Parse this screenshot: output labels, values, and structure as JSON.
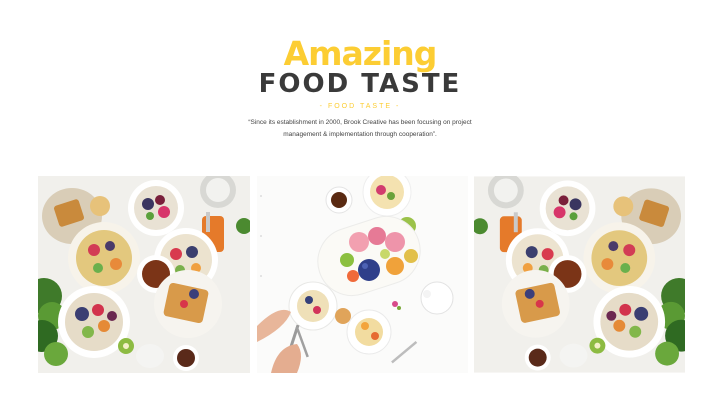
{
  "colors": {
    "accent": "#fccd33",
    "heading": "#3a3a3a",
    "text": "#444444",
    "background": "#ffffff"
  },
  "header": {
    "title_accent": "Amazing",
    "title_main": "FOOD TASTE",
    "subtitle": "- FOOD TASTE -",
    "description_line1": "“Since its establishment in 2000, Brook Creative has been focusing on project",
    "description_line2": "management & implementation through cooperation”."
  },
  "gallery": {
    "photos": [
      {
        "subject": "breakfast-spread-photo"
      },
      {
        "subject": "fruit-platter-photo"
      },
      {
        "subject": "breakfast-spread-photo-mirrored"
      }
    ]
  }
}
